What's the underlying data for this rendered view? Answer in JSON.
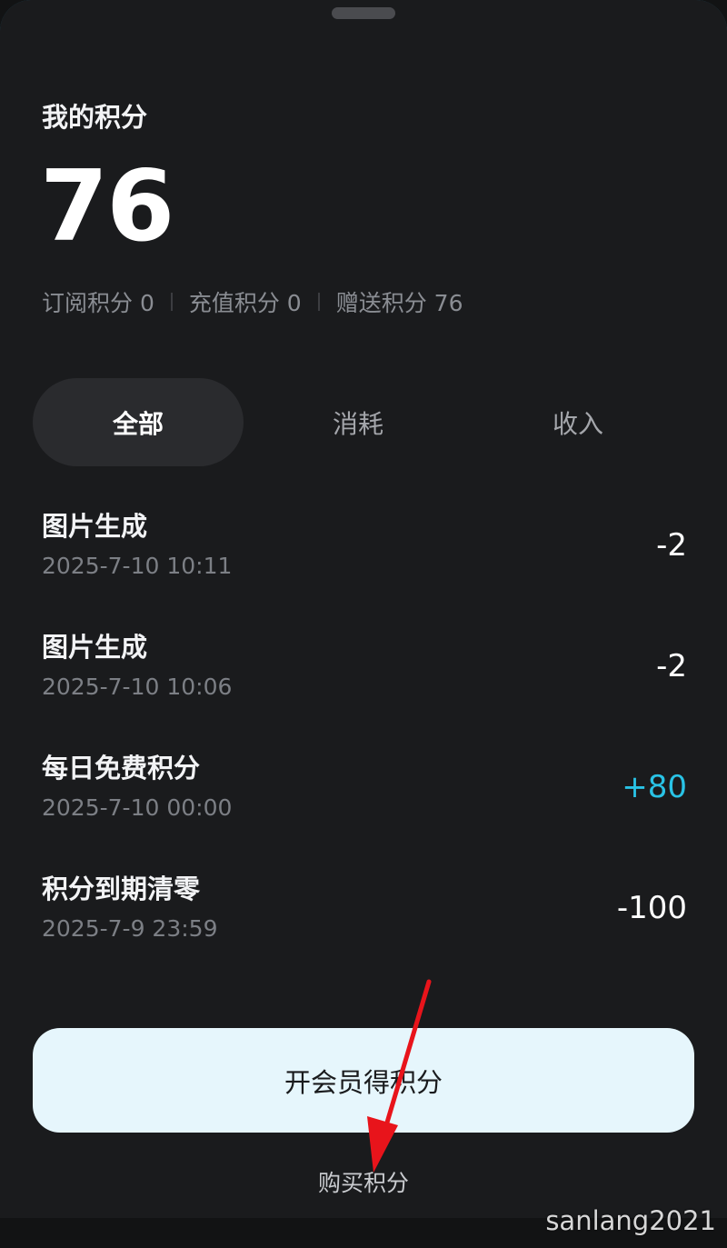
{
  "header": {
    "title": "我的积分",
    "total_points": "76"
  },
  "breakdown": [
    {
      "label": "订阅积分 0"
    },
    {
      "label": "充值积分 0"
    },
    {
      "label": "赠送积分 76"
    }
  ],
  "tabs": [
    {
      "label": "全部",
      "active": true
    },
    {
      "label": "消耗",
      "active": false
    },
    {
      "label": "收入",
      "active": false
    }
  ],
  "records": [
    {
      "name": "图片生成",
      "time": "2025-7-10 10:11",
      "amount": "-2"
    },
    {
      "name": "图片生成",
      "time": "2025-7-10 10:06",
      "amount": "-2"
    },
    {
      "name": "每日免费积分",
      "time": "2025-7-10 00:00",
      "amount": "+80"
    },
    {
      "name": "积分到期清零",
      "time": "2025-7-9 23:59",
      "amount": "-100"
    }
  ],
  "actions": {
    "primary_label": "开会员得积分",
    "secondary_label": "购买积分"
  },
  "watermark": "sanlang2021",
  "colors": {
    "positive": "#29c3e6",
    "annotation_arrow": "#e8141b",
    "primary_button_bg": "#e6f6fc"
  }
}
